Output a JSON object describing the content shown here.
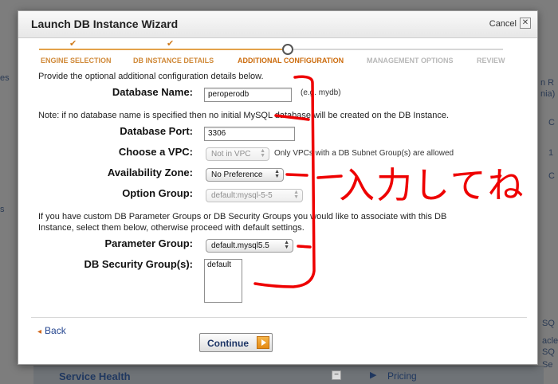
{
  "background": {
    "fragments": [
      "es",
      "s",
      "n R",
      "nia)",
      "C",
      "1",
      "C",
      "SQ",
      "acle",
      "SQ",
      "Se"
    ],
    "footer": {
      "left_title": "Service Health",
      "minus": "−",
      "arrow": "▶",
      "right_link": "Pricing"
    }
  },
  "dialog": {
    "title": "Launch DB Instance Wizard",
    "cancel_label": "Cancel",
    "close_glyph": "✕"
  },
  "steps": {
    "check_glyph": "✔",
    "items": [
      {
        "label": "ENGINE SELECTION",
        "state": "done"
      },
      {
        "label": "DB INSTANCE DETAILS",
        "state": "done"
      },
      {
        "label": "ADDITIONAL CONFIGURATION",
        "state": "current"
      },
      {
        "label": "MANAGEMENT OPTIONS",
        "state": "todo"
      },
      {
        "label": "REVIEW",
        "state": "todo"
      }
    ]
  },
  "form": {
    "intro": "Provide the optional additional configuration details below.",
    "db_name": {
      "label": "Database Name:",
      "value": "peroperodb",
      "hint": "(e.g. mydb)"
    },
    "note": "Note: if no database name is specified then no initial MySQL database will be created on the DB Instance.",
    "port": {
      "label": "Database Port:",
      "value": "3306"
    },
    "vpc": {
      "label": "Choose a VPC:",
      "value": "Not in VPC",
      "hint": "Only VPCs with a DB Subnet Group(s) are allowed"
    },
    "az": {
      "label": "Availability Zone:",
      "value": "No Preference"
    },
    "option_group": {
      "label": "Option Group:",
      "value": "default:mysql-5-5"
    },
    "param_text_1": "If you have custom DB Parameter Groups or DB Security Groups you would like to associate with this DB",
    "param_text_2": "Instance, select them below, otherwise proceed with default settings.",
    "param_group": {
      "label": "Parameter Group:",
      "value": "default.mysql5.5"
    },
    "sec_group": {
      "label": "DB Security Group(s):",
      "options": [
        "default"
      ]
    }
  },
  "nav": {
    "back_arrow": "◂",
    "back_label": "Back",
    "continue_label": "Continue"
  },
  "annotation": {
    "text": "入力してね",
    "color": "#ee0000"
  }
}
